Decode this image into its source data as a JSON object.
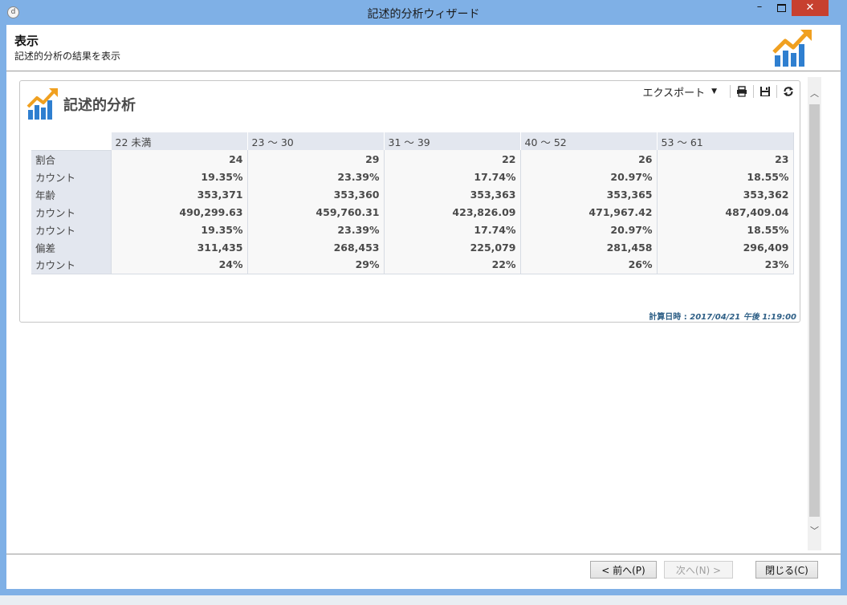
{
  "window": {
    "title": "記述的分析ウィザード",
    "app_icon": "d",
    "min_glyph": "–",
    "close_glyph": "✕"
  },
  "header": {
    "title": "表示",
    "subtitle": "記述的分析の結果を表示"
  },
  "panel": {
    "title": "記述的分析",
    "toolbar": {
      "export_label": "エクスポート",
      "icons": [
        "print-icon",
        "save-icon",
        "refresh-icon"
      ]
    },
    "table": {
      "columns": [
        "22 未満",
        "23 ～ 30",
        "31 ～ 39",
        "40 ～ 52",
        "53 ～ 61"
      ],
      "rows": [
        {
          "label": "割合",
          "values": [
            "24",
            "29",
            "22",
            "26",
            "23"
          ]
        },
        {
          "label": "カウント",
          "values": [
            "19.35%",
            "23.39%",
            "17.74%",
            "20.97%",
            "18.55%"
          ]
        },
        {
          "label": "年齢",
          "values": [
            "353,371",
            "353,360",
            "353,363",
            "353,365",
            "353,362"
          ]
        },
        {
          "label": "カウント",
          "values": [
            "490,299.63",
            "459,760.31",
            "423,826.09",
            "471,967.42",
            "487,409.04"
          ]
        },
        {
          "label": "カウント",
          "values": [
            "19.35%",
            "23.39%",
            "17.74%",
            "20.97%",
            "18.55%"
          ]
        },
        {
          "label": "偏差",
          "values": [
            "311,435",
            "268,453",
            "225,079",
            "281,458",
            "296,409"
          ]
        },
        {
          "label": "カウント",
          "values": [
            "24%",
            "29%",
            "22%",
            "26%",
            "23%"
          ]
        }
      ]
    },
    "calc_label": "計算日時 :",
    "calc_time": "2017/04/21 午後 1:19:00"
  },
  "buttons": {
    "prev": "< 前へ(P)",
    "next": "次へ(N) >",
    "close": "閉じる(C)"
  },
  "colors": {
    "logo_orange": "#f0a020",
    "logo_blue": "#2f7fd0",
    "titlebar": "#7fb0e6",
    "close_red": "#c7402f"
  }
}
